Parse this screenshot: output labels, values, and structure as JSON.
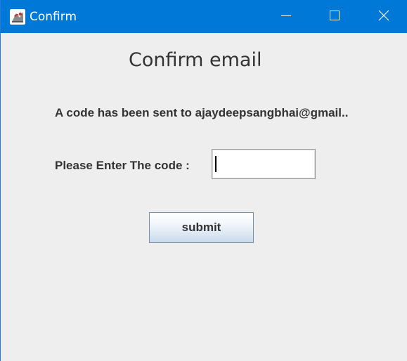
{
  "window": {
    "title": "Confirm",
    "app_icon": "java-app-icon",
    "controls": {
      "minimize_icon": "minimize-icon",
      "maximize_icon": "maximize-icon",
      "close_icon": "close-icon"
    },
    "accent_color": "#0078d7"
  },
  "form": {
    "heading": "Confirm email",
    "message": "A code has been sent to ajaydeepsangbhai@gmail..",
    "code_label": "Please Enter The code :",
    "code_value": "",
    "submit_label": "submit"
  }
}
